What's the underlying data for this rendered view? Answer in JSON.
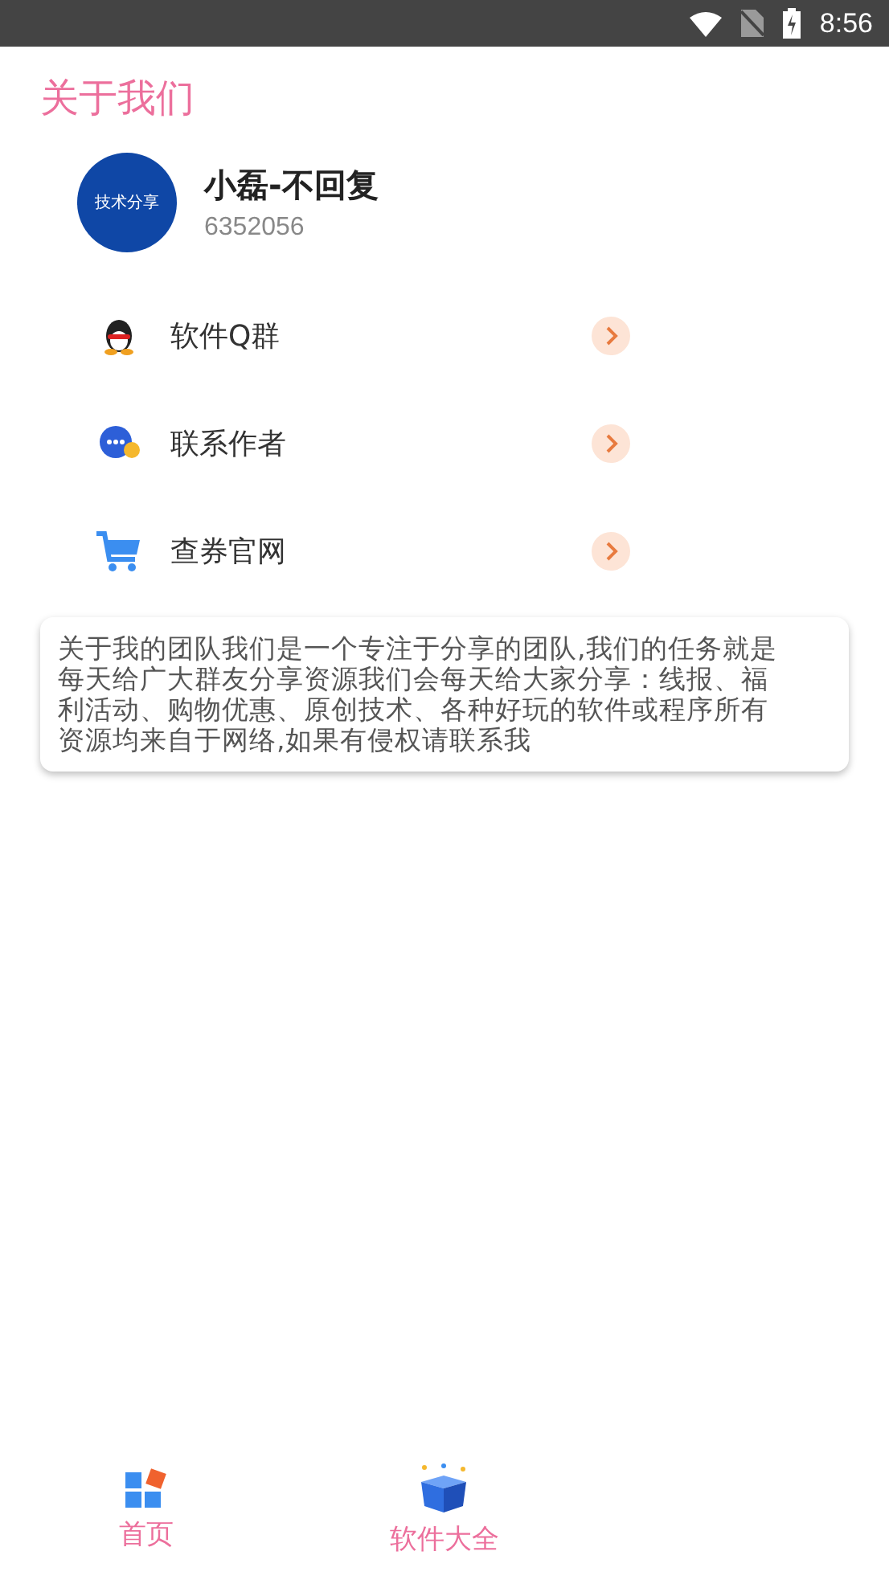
{
  "status_bar": {
    "time": "8:56"
  },
  "header": {
    "title": "关于我们"
  },
  "profile": {
    "avatar_text": "技术分享",
    "name": "小磊-不回复",
    "id": "6352056"
  },
  "menu": [
    {
      "kind": "qq",
      "label": "软件Q群"
    },
    {
      "kind": "chat",
      "label": "联系作者"
    },
    {
      "kind": "cart",
      "label": "查券官网"
    }
  ],
  "about": {
    "text": "关于我的团队我们是一个专注于分享的团队,我们的任务就是每天给广大群友分享资源我们会每天给大家分享：线报、福利活动、购物优惠、原创技术、各种好玩的软件或程序所有资源均来自于网络,如果有侵权请联系我"
  },
  "bottom_nav": [
    {
      "kind": "home",
      "label": "首页",
      "selected": true
    },
    {
      "kind": "box",
      "label": "软件大全",
      "selected": true
    }
  ]
}
